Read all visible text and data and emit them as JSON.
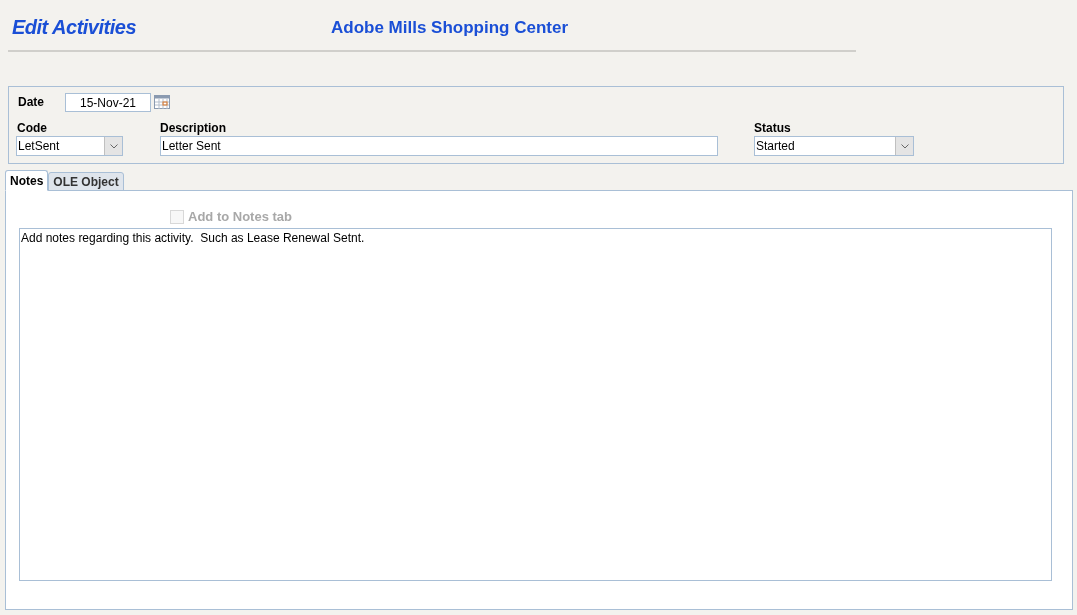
{
  "header": {
    "title": "Edit Activities",
    "property": "Adobe Mills Shopping Center"
  },
  "form": {
    "date": {
      "label": "Date",
      "value": "15-Nov-21"
    },
    "code": {
      "label": "Code",
      "value": "LetSent"
    },
    "description": {
      "label": "Description",
      "value": "Letter Sent"
    },
    "status": {
      "label": "Status",
      "value": "Started"
    }
  },
  "tabs": [
    {
      "label": "Notes",
      "selected": true
    },
    {
      "label": "OLE Object",
      "selected": false
    }
  ],
  "notes": {
    "checkbox": {
      "label": "Add to Notes tab",
      "checked": false,
      "disabled": true
    },
    "text": "Add notes regarding this activity.  Such as Lease Renewal Setnt."
  }
}
